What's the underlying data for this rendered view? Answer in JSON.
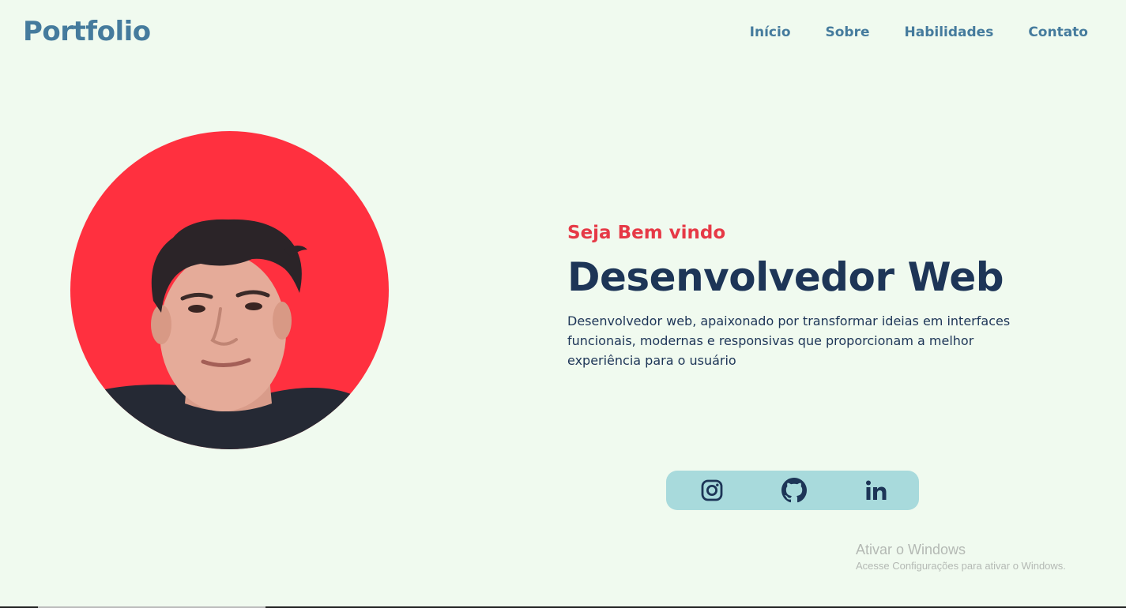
{
  "header": {
    "logo": "Portfolio",
    "nav": [
      {
        "label": "Início"
      },
      {
        "label": "Sobre"
      },
      {
        "label": "Habilidades"
      },
      {
        "label": "Contato"
      }
    ]
  },
  "hero": {
    "greeting": "Seja Bem vindo",
    "title": "Desenvolvedor Web",
    "description": "Desenvolvedor web, apaixonado por transformar ideias em interfaces funcionais, modernas e responsivas que proporcionam a melhor experiência para o usuário"
  },
  "social": [
    {
      "icon": "instagram-icon"
    },
    {
      "icon": "github-icon"
    },
    {
      "icon": "linkedin-icon"
    }
  ],
  "watermark": {
    "title": "Ativar o Windows",
    "subtitle": "Acesse Configurações para ativar o Windows."
  },
  "colors": {
    "background": "#f0faef",
    "brand": "#457b9d",
    "accent_red": "#e63946",
    "navy": "#1d3557",
    "avatar_bg": "#ff303f",
    "social_bar": "#a8dadc"
  }
}
